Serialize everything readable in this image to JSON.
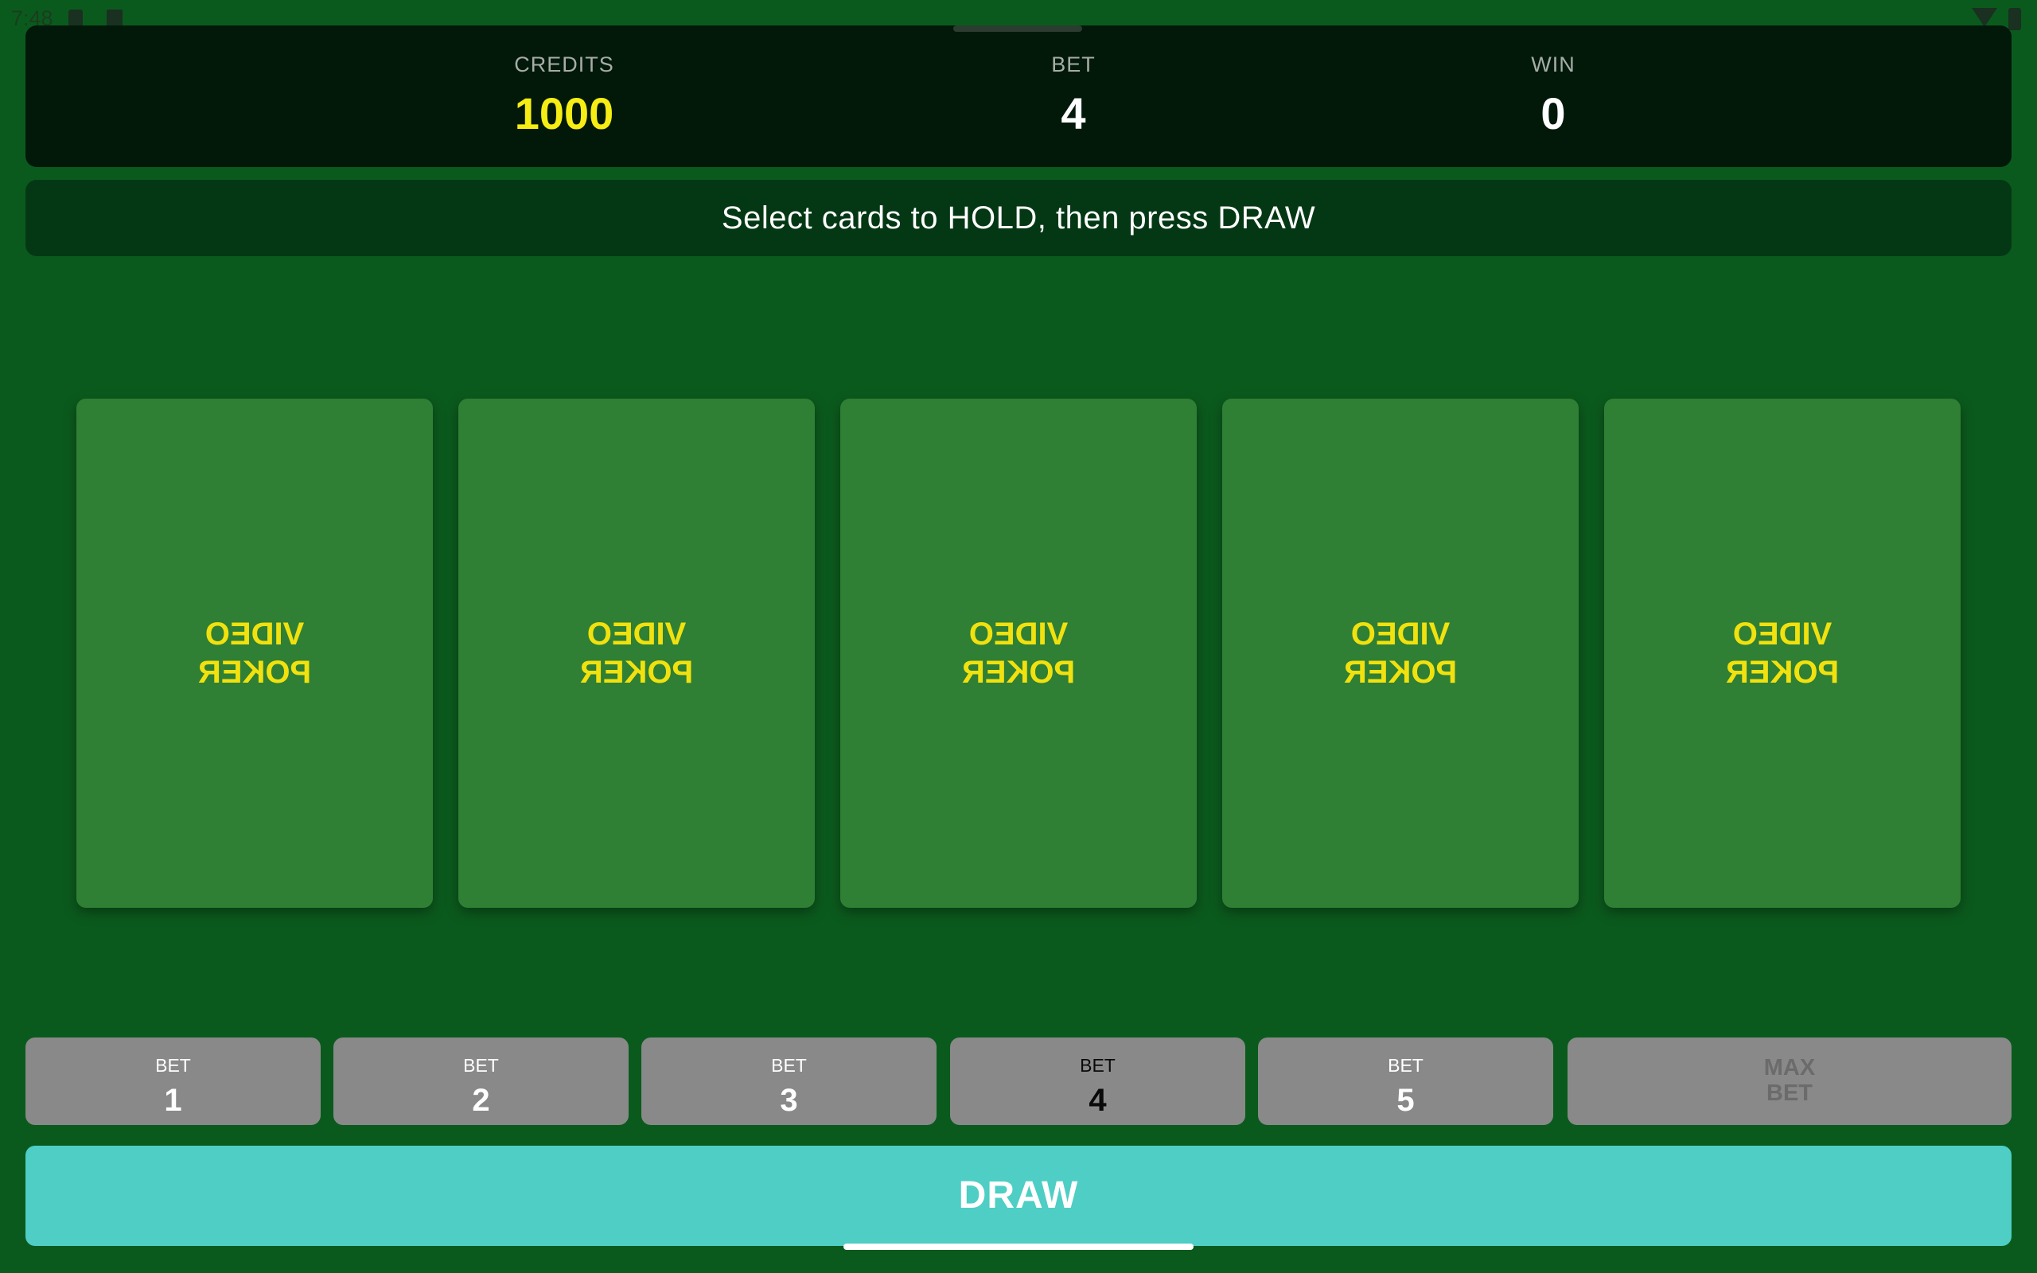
{
  "status_bar": {
    "time": "7:48"
  },
  "scoreboard": {
    "credits_label": "CREDITS",
    "credits_value": "1000",
    "bet_label": "BET",
    "bet_value": "4",
    "win_label": "WIN",
    "win_value": "0"
  },
  "message": "Select cards to HOLD, then press DRAW",
  "cards": [
    {
      "line1": "VIDEO",
      "line2": "POKER"
    },
    {
      "line1": "VIDEO",
      "line2": "POKER"
    },
    {
      "line1": "VIDEO",
      "line2": "POKER"
    },
    {
      "line1": "VIDEO",
      "line2": "POKER"
    },
    {
      "line1": "VIDEO",
      "line2": "POKER"
    }
  ],
  "bet_buttons": [
    {
      "label": "BET",
      "value": "1"
    },
    {
      "label": "BET",
      "value": "2"
    },
    {
      "label": "BET",
      "value": "3"
    },
    {
      "label": "BET",
      "value": "4"
    },
    {
      "label": "BET",
      "value": "5"
    }
  ],
  "max_bet": {
    "line1": "MAX",
    "line2": "BET"
  },
  "draw_label": "DRAW",
  "colors": {
    "table_green": "#0b5a1d",
    "panel_dark": "#02190a",
    "card_green": "#2f7f34",
    "card_text_yellow": "#f1e10f",
    "credits_yellow": "#f6ed14",
    "bet_button_gray": "#898989",
    "draw_teal": "#4ecec4"
  }
}
